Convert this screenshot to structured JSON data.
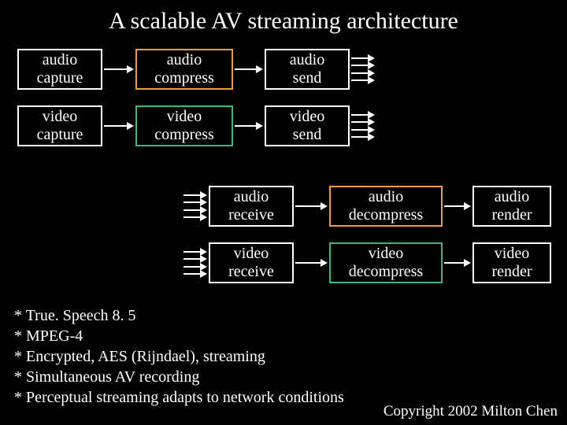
{
  "title": "A scalable AV streaming architecture",
  "boxes": {
    "audio_capture": "audio\ncapture",
    "audio_compress": "audio\ncompress",
    "audio_send": "audio\nsend",
    "video_capture": "video\ncapture",
    "video_compress": "video\ncompress",
    "video_send": "video\nsend",
    "audio_receive": "audio\nreceive",
    "audio_decompress": "audio\ndecompress",
    "audio_render": "audio\nrender",
    "video_receive": "video\nreceive",
    "video_decompress": "video\ndecompress",
    "video_render": "video\nrender"
  },
  "notes": [
    "* True. Speech 8. 5",
    "* MPEG-4",
    "* Encrypted, AES (Rijndael), streaming",
    "* Simultaneous AV recording",
    "* Perceptual streaming adapts to network conditions"
  ],
  "copyright": "Copyright 2002 Milton Chen"
}
